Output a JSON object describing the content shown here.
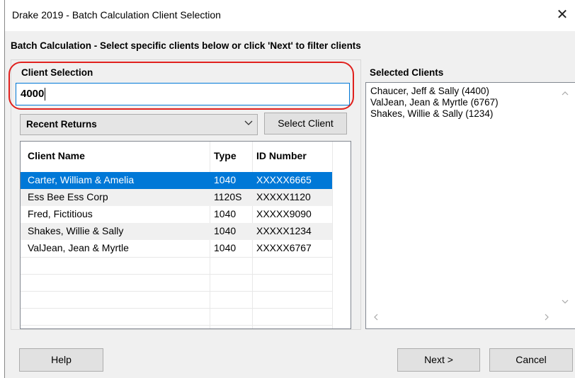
{
  "window": {
    "title": "Drake 2019 - Batch Calculation Client Selection",
    "close_glyph": "✕"
  },
  "instruction": "Batch Calculation - Select specific clients below or click 'Next' to filter clients",
  "client_selection": {
    "label": "Client Selection",
    "input_value": "4000",
    "highlight_color": "#e0201d"
  },
  "filter": {
    "selected": "Recent Returns",
    "arrow_icon": "chevron-down-icon"
  },
  "select_client_button": "Select Client",
  "client_list": {
    "columns": [
      "Client Name",
      "Type",
      "ID Number"
    ],
    "rows": [
      {
        "name": "Carter, William & Amelia",
        "type": "1040",
        "id": "XXXXX6665",
        "selected": true
      },
      {
        "name": "Ess Bee Ess Corp",
        "type": "1120S",
        "id": "XXXXX1120",
        "selected": false
      },
      {
        "name": "Fred, Fictitious",
        "type": "1040",
        "id": "XXXXX9090",
        "selected": false
      },
      {
        "name": "Shakes, Willie & Sally",
        "type": "1040",
        "id": "XXXXX1234",
        "selected": false
      },
      {
        "name": "ValJean, Jean & Myrtle",
        "type": "1040",
        "id": "XXXXX6767",
        "selected": false
      }
    ],
    "selected_color": "#0078d7",
    "alt_row_color": "#f0f0f0"
  },
  "selected_clients": {
    "label": "Selected Clients",
    "items": [
      "Chaucer, Jeff & Sally (4400)",
      "ValJean, Jean & Myrtle (6767)",
      "Shakes, Willie & Sally (1234)"
    ]
  },
  "footer": {
    "help": "Help",
    "next": "Next >",
    "cancel": "Cancel"
  }
}
